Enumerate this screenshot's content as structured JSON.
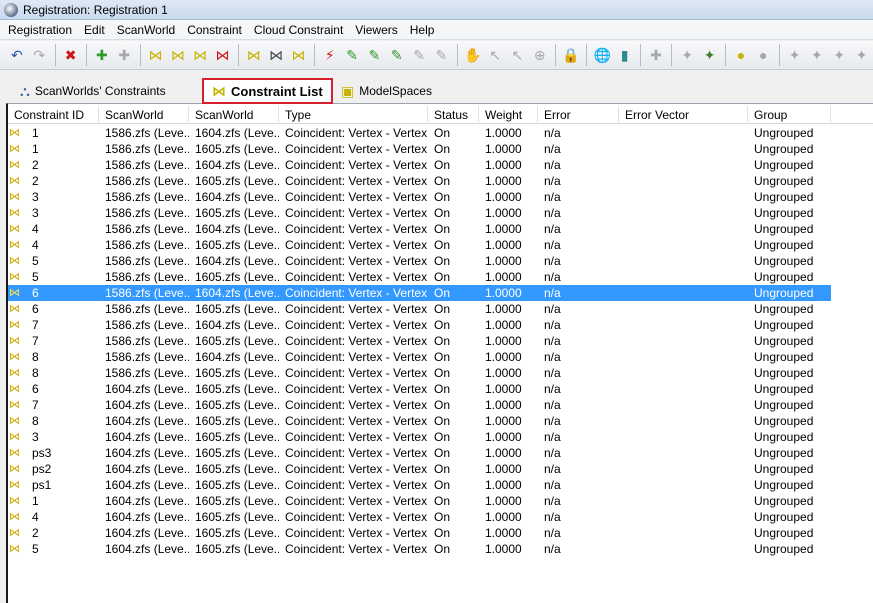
{
  "window": {
    "title": "Registration: Registration 1"
  },
  "menu": [
    "Registration",
    "Edit",
    "ScanWorld",
    "Constraint",
    "Cloud Constraint",
    "Viewers",
    "Help"
  ],
  "tabs": [
    {
      "label": "ScanWorlds' Constraints",
      "icon": "scanworld-constraints-icon"
    },
    {
      "label": "Constraint List",
      "icon": "constraint-list-icon",
      "active": true
    },
    {
      "label": "ModelSpaces",
      "icon": "modelspaces-icon"
    }
  ],
  "table": {
    "columns": [
      "Constraint ID",
      "ScanWorld",
      "ScanWorld",
      "Type",
      "Status",
      "Weight",
      "Error",
      "Error Vector",
      "Group"
    ],
    "selected_row": 10,
    "rows": [
      [
        "1",
        "1586.zfs (Leve...",
        "1604.zfs (Leve...",
        "Coincident: Vertex - Vertex",
        "On",
        "1.0000",
        "n/a",
        "",
        "Ungrouped"
      ],
      [
        "1",
        "1586.zfs (Leve...",
        "1605.zfs (Leve...",
        "Coincident: Vertex - Vertex",
        "On",
        "1.0000",
        "n/a",
        "",
        "Ungrouped"
      ],
      [
        "2",
        "1586.zfs (Leve...",
        "1604.zfs (Leve...",
        "Coincident: Vertex - Vertex",
        "On",
        "1.0000",
        "n/a",
        "",
        "Ungrouped"
      ],
      [
        "2",
        "1586.zfs (Leve...",
        "1605.zfs (Leve...",
        "Coincident: Vertex - Vertex",
        "On",
        "1.0000",
        "n/a",
        "",
        "Ungrouped"
      ],
      [
        "3",
        "1586.zfs (Leve...",
        "1604.zfs (Leve...",
        "Coincident: Vertex - Vertex",
        "On",
        "1.0000",
        "n/a",
        "",
        "Ungrouped"
      ],
      [
        "3",
        "1586.zfs (Leve...",
        "1605.zfs (Leve...",
        "Coincident: Vertex - Vertex",
        "On",
        "1.0000",
        "n/a",
        "",
        "Ungrouped"
      ],
      [
        "4",
        "1586.zfs (Leve...",
        "1604.zfs (Leve...",
        "Coincident: Vertex - Vertex",
        "On",
        "1.0000",
        "n/a",
        "",
        "Ungrouped"
      ],
      [
        "4",
        "1586.zfs (Leve...",
        "1605.zfs (Leve...",
        "Coincident: Vertex - Vertex",
        "On",
        "1.0000",
        "n/a",
        "",
        "Ungrouped"
      ],
      [
        "5",
        "1586.zfs (Leve...",
        "1604.zfs (Leve...",
        "Coincident: Vertex - Vertex",
        "On",
        "1.0000",
        "n/a",
        "",
        "Ungrouped"
      ],
      [
        "5",
        "1586.zfs (Leve...",
        "1605.zfs (Leve...",
        "Coincident: Vertex - Vertex",
        "On",
        "1.0000",
        "n/a",
        "",
        "Ungrouped"
      ],
      [
        "6",
        "1586.zfs (Leve...",
        "1604.zfs (Leve...",
        "Coincident: Vertex - Vertex",
        "On",
        "1.0000",
        "n/a",
        "",
        "Ungrouped"
      ],
      [
        "6",
        "1586.zfs (Leve...",
        "1605.zfs (Leve...",
        "Coincident: Vertex - Vertex",
        "On",
        "1.0000",
        "n/a",
        "",
        "Ungrouped"
      ],
      [
        "7",
        "1586.zfs (Leve...",
        "1604.zfs (Leve...",
        "Coincident: Vertex - Vertex",
        "On",
        "1.0000",
        "n/a",
        "",
        "Ungrouped"
      ],
      [
        "7",
        "1586.zfs (Leve...",
        "1605.zfs (Leve...",
        "Coincident: Vertex - Vertex",
        "On",
        "1.0000",
        "n/a",
        "",
        "Ungrouped"
      ],
      [
        "8",
        "1586.zfs (Leve...",
        "1604.zfs (Leve...",
        "Coincident: Vertex - Vertex",
        "On",
        "1.0000",
        "n/a",
        "",
        "Ungrouped"
      ],
      [
        "8",
        "1586.zfs (Leve...",
        "1605.zfs (Leve...",
        "Coincident: Vertex - Vertex",
        "On",
        "1.0000",
        "n/a",
        "",
        "Ungrouped"
      ],
      [
        "6",
        "1604.zfs (Leve...",
        "1605.zfs (Leve...",
        "Coincident: Vertex - Vertex",
        "On",
        "1.0000",
        "n/a",
        "",
        "Ungrouped"
      ],
      [
        "7",
        "1604.zfs (Leve...",
        "1605.zfs (Leve...",
        "Coincident: Vertex - Vertex",
        "On",
        "1.0000",
        "n/a",
        "",
        "Ungrouped"
      ],
      [
        "8",
        "1604.zfs (Leve...",
        "1605.zfs (Leve...",
        "Coincident: Vertex - Vertex",
        "On",
        "1.0000",
        "n/a",
        "",
        "Ungrouped"
      ],
      [
        "3",
        "1604.zfs (Leve...",
        "1605.zfs (Leve...",
        "Coincident: Vertex - Vertex",
        "On",
        "1.0000",
        "n/a",
        "",
        "Ungrouped"
      ],
      [
        "ps3",
        "1604.zfs (Leve...",
        "1605.zfs (Leve...",
        "Coincident: Vertex - Vertex",
        "On",
        "1.0000",
        "n/a",
        "",
        "Ungrouped"
      ],
      [
        "ps2",
        "1604.zfs (Leve...",
        "1605.zfs (Leve...",
        "Coincident: Vertex - Vertex",
        "On",
        "1.0000",
        "n/a",
        "",
        "Ungrouped"
      ],
      [
        "ps1",
        "1604.zfs (Leve...",
        "1605.zfs (Leve...",
        "Coincident: Vertex - Vertex",
        "On",
        "1.0000",
        "n/a",
        "",
        "Ungrouped"
      ],
      [
        "1",
        "1604.zfs (Leve...",
        "1605.zfs (Leve...",
        "Coincident: Vertex - Vertex",
        "On",
        "1.0000",
        "n/a",
        "",
        "Ungrouped"
      ],
      [
        "4",
        "1604.zfs (Leve...",
        "1605.zfs (Leve...",
        "Coincident: Vertex - Vertex",
        "On",
        "1.0000",
        "n/a",
        "",
        "Ungrouped"
      ],
      [
        "2",
        "1604.zfs (Leve...",
        "1605.zfs (Leve...",
        "Coincident: Vertex - Vertex",
        "On",
        "1.0000",
        "n/a",
        "",
        "Ungrouped"
      ],
      [
        "5",
        "1604.zfs (Leve...",
        "1605.zfs (Leve...",
        "Coincident: Vertex - Vertex",
        "On",
        "1.0000",
        "n/a",
        "",
        "Ungrouped"
      ]
    ]
  },
  "colors": {
    "selection": "#3399ff",
    "active_tab_outline": "#d3202a",
    "constraint_icon": "#c9a800"
  }
}
